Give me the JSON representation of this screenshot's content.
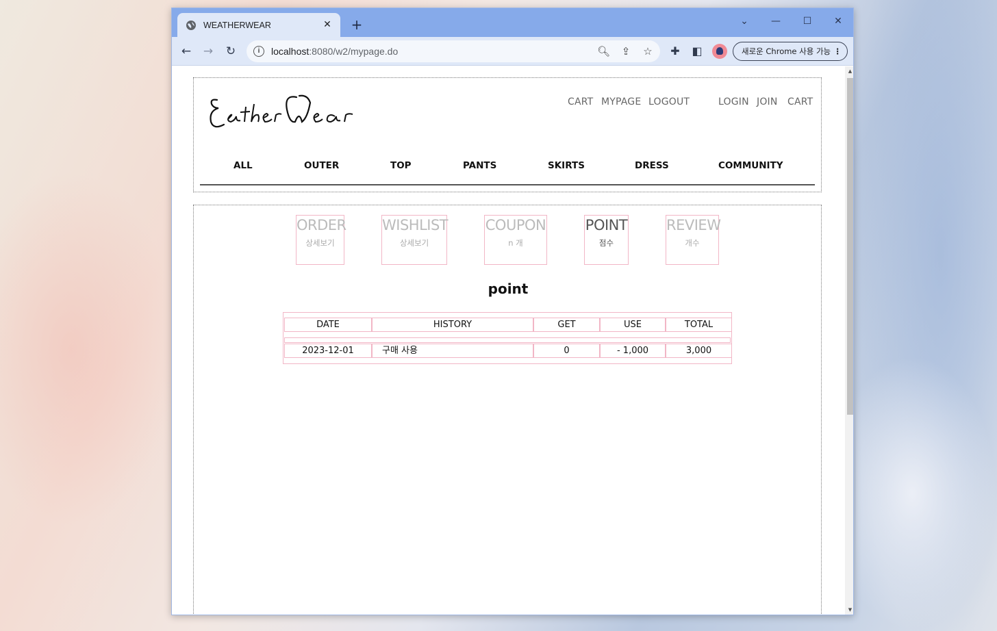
{
  "browser": {
    "tab_title": "WEATHERWEAR",
    "url_host": "localhost",
    "url_path": ":8080/w2/mypage.do",
    "chrome_pill": "새로운 Chrome 사용 가능"
  },
  "site": {
    "logo_text": "Eather Wear",
    "util_links": [
      "CART",
      "MYPAGE",
      "LOGOUT",
      "LOGIN",
      "JOIN",
      "CART"
    ],
    "nav": [
      "ALL",
      "OUTER",
      "TOP",
      "PANTS",
      "SKIRTS",
      "DRESS",
      "COMMUNITY"
    ]
  },
  "mypage_menu": [
    {
      "title": "ORDER",
      "sub": "상세보기",
      "active": false
    },
    {
      "title": "WISHLIST",
      "sub": "상세보기",
      "active": false
    },
    {
      "title": "COUPON",
      "sub": "n 개",
      "active": false
    },
    {
      "title": "POINT",
      "sub": "점수",
      "active": true
    },
    {
      "title": "REVIEW",
      "sub": "개수",
      "active": false
    }
  ],
  "section_title": "point",
  "point_table": {
    "headers": [
      "DATE",
      "HISTORY",
      "GET",
      "USE",
      "TOTAL"
    ],
    "rows": [
      [
        "2023-12-01",
        "구매 사용",
        "0",
        "- 1,000",
        "3,000"
      ]
    ]
  }
}
